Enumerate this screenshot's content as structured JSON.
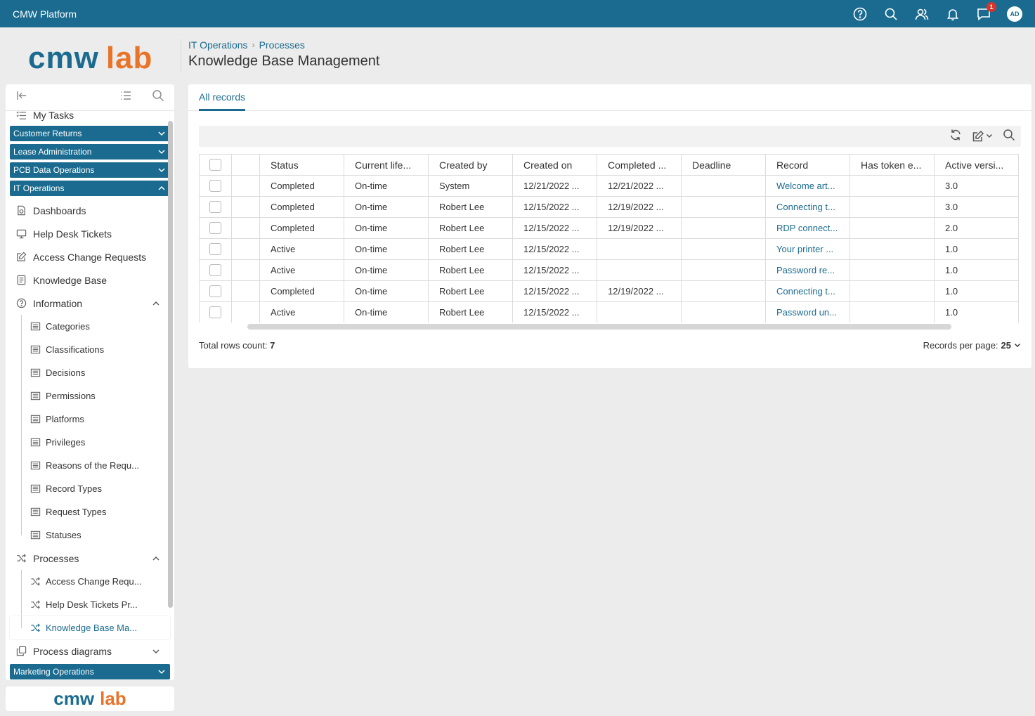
{
  "topbar": {
    "title": "CMW Platform",
    "notification_badge": "1",
    "avatar_initials": "AD"
  },
  "logo": {
    "part1": "cmw",
    "part2": "lab"
  },
  "header": {
    "breadcrumb": [
      "IT Operations",
      "Processes"
    ],
    "title": "Knowledge Base Management"
  },
  "sidebar": {
    "my_tasks": "My Tasks",
    "groups": [
      "Customer Returns",
      "Lease Administration",
      "PCB Data Operations",
      "IT Operations"
    ],
    "it_items": [
      "Dashboards",
      "Help Desk Tickets",
      "Access Change Requests",
      "Knowledge Base"
    ],
    "information_label": "Information",
    "information_items": [
      "Categories",
      "Classifications",
      "Decisions",
      "Permissions",
      "Platforms",
      "Privileges",
      "Reasons of the Requ...",
      "Record Types",
      "Request Types",
      "Statuses"
    ],
    "processes_label": "Processes",
    "process_items": [
      "Access Change Requ...",
      "Help Desk Tickets Pr...",
      "Knowledge Base Ma..."
    ],
    "process_diagrams_label": "Process diagrams",
    "last_group": "Marketing Operations"
  },
  "main": {
    "tab": "All records",
    "columns": [
      "Status",
      "Current life...",
      "Created by",
      "Created on",
      "Completed ...",
      "Deadline",
      "Record",
      "Has token e...",
      "Active versi..."
    ],
    "rows": [
      [
        "Completed",
        "On-time",
        "System",
        "12/21/2022 ...",
        "12/21/2022 ...",
        "",
        "Welcome art...",
        "",
        "3.0"
      ],
      [
        "Completed",
        "On-time",
        "Robert Lee",
        "12/15/2022 ...",
        "12/19/2022 ...",
        "",
        "Connecting t...",
        "",
        "3.0"
      ],
      [
        "Completed",
        "On-time",
        "Robert Lee",
        "12/15/2022 ...",
        "12/19/2022 ...",
        "",
        "RDP connect...",
        "",
        "2.0"
      ],
      [
        "Active",
        "On-time",
        "Robert Lee",
        "12/15/2022 ...",
        "",
        "",
        "Your printer ...",
        "",
        "1.0"
      ],
      [
        "Active",
        "On-time",
        "Robert Lee",
        "12/15/2022 ...",
        "",
        "",
        "Password re...",
        "",
        "1.0"
      ],
      [
        "Completed",
        "On-time",
        "Robert Lee",
        "12/15/2022 ...",
        "12/19/2022 ...",
        "",
        "Connecting t...",
        "",
        "1.0"
      ],
      [
        "Active",
        "On-time",
        "Robert Lee",
        "12/15/2022 ...",
        "",
        "",
        "Password un...",
        "",
        "1.0"
      ]
    ],
    "total_label": "Total rows count:",
    "total_value": "7",
    "rpp_label": "Records per page:",
    "rpp_value": "25"
  },
  "colors": {
    "brand": "#1a6b8f",
    "accent": "#e8742a",
    "badge": "#d9342b"
  }
}
